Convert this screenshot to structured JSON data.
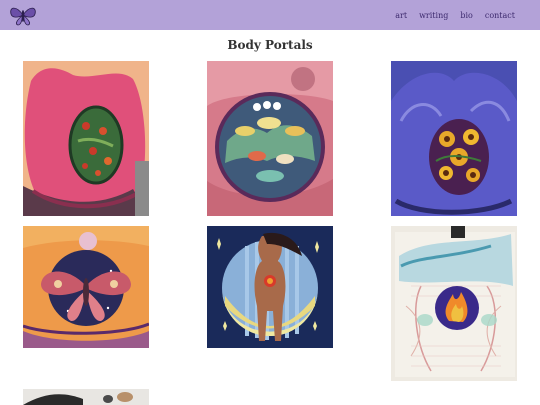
{
  "nav": {
    "logo_icon": "moth-logo-icon",
    "links": [
      "art",
      "writing",
      "bio",
      "contact"
    ]
  },
  "page": {
    "title": "Body Portals"
  },
  "gallery": {
    "items": [
      {
        "icon": "painting-torso-berries"
      },
      {
        "icon": "painting-mushroom-portal"
      },
      {
        "icon": "painting-sunflower-portal"
      },
      {
        "icon": "painting-moth-belly"
      },
      {
        "icon": "painting-figure-moon"
      },
      {
        "icon": "painting-flame-portal"
      },
      {
        "icon": "painting-partial"
      }
    ]
  },
  "colors": {
    "navbar": "#b3a2d8",
    "link": "#3d2a6e"
  }
}
